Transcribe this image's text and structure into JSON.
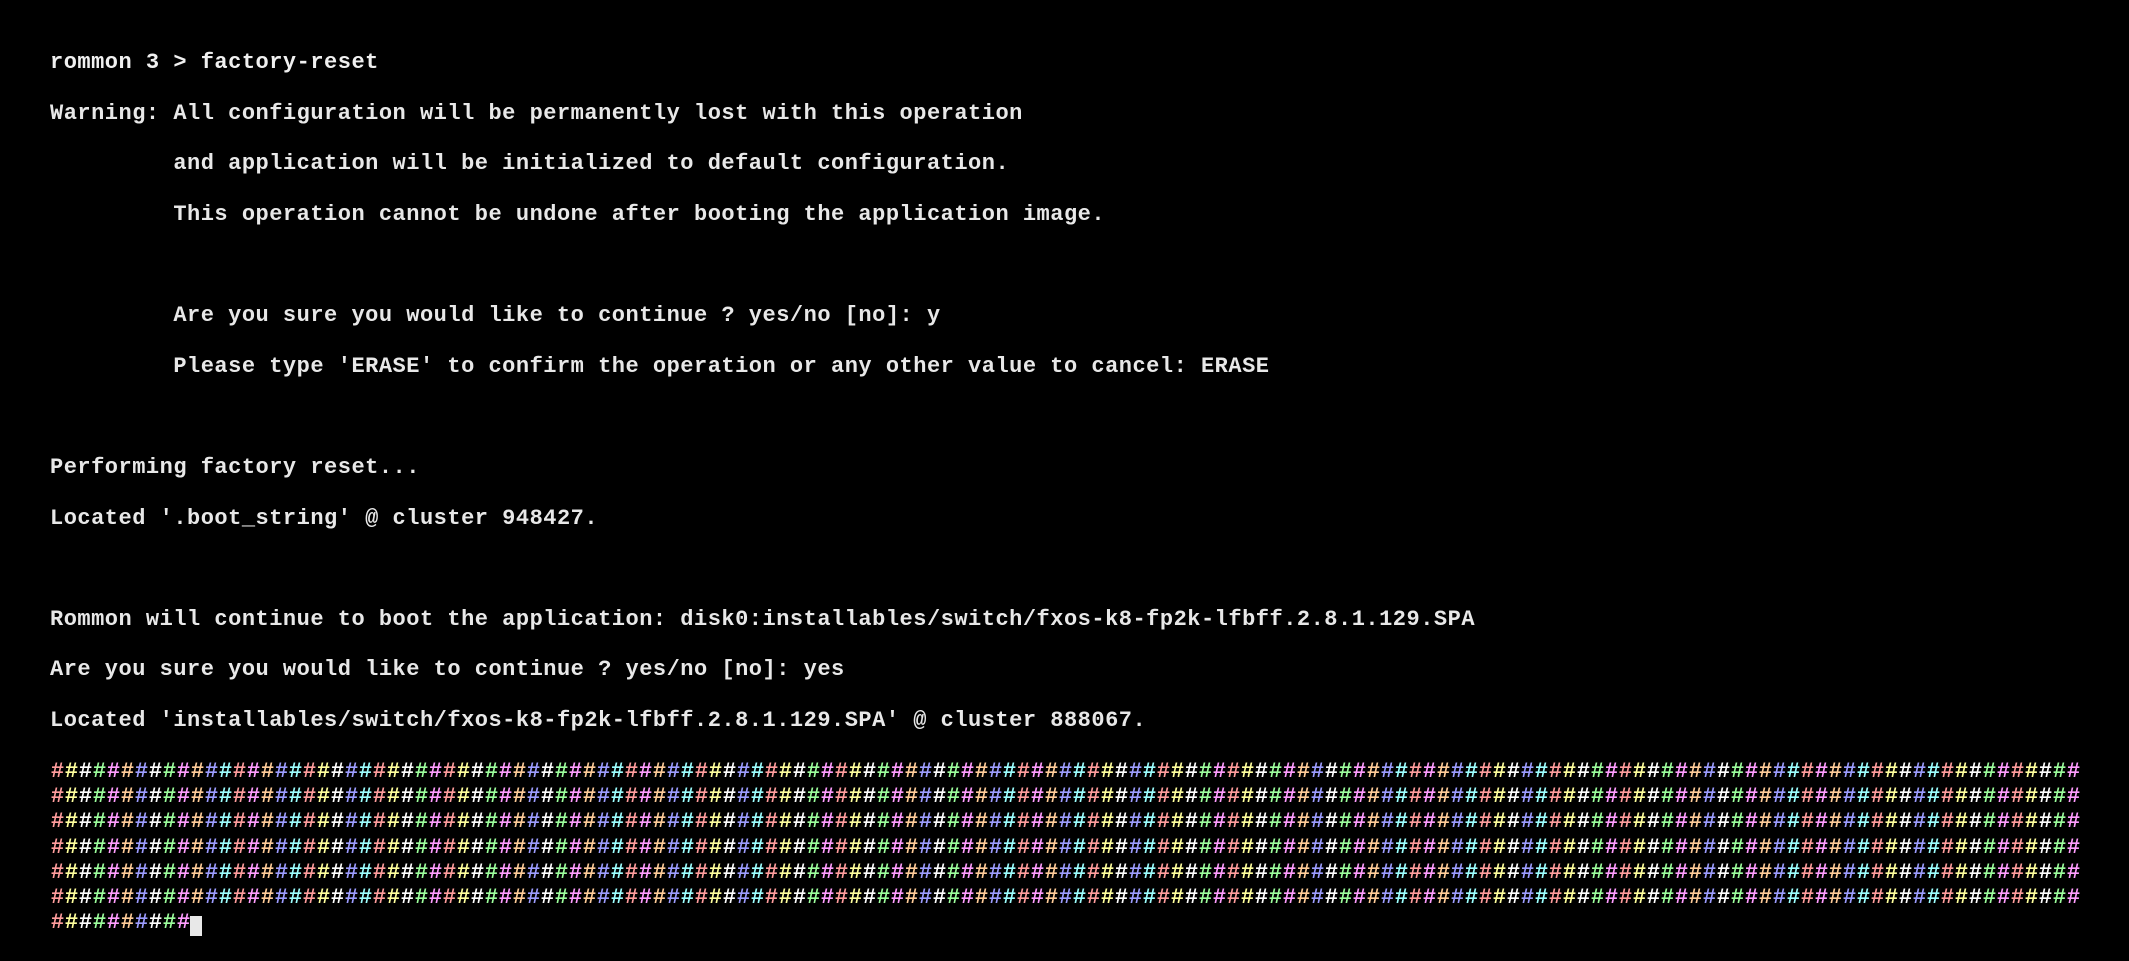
{
  "terminal": {
    "prompt_line": "rommon 3 > factory-reset",
    "warning_l1": "Warning: All configuration will be permanently lost with this operation",
    "warning_l2": "         and application will be initialized to default configuration.",
    "warning_l3": "         This operation cannot be undone after booting the application image.",
    "confirm_l1": "         Are you sure you would like to continue ? yes/no [no]: y",
    "confirm_l2": "         Please type 'ERASE' to confirm the operation or any other value to cancel: ERASE",
    "performing": "Performing factory reset...",
    "located1": "Located '.boot_string' @ cluster 948427.",
    "rommon_boot": "Rommon will continue to boot the application: disk0:installables/switch/fxos-k8-fp2k-lfbff.2.8.1.129.SPA",
    "confirm2": "Are you sure you would like to continue ? yes/no [no]: yes",
    "located2": "Located 'installables/switch/fxos-k8-fp2k-lfbff.2.8.1.129.SPA' @ cluster 888067.",
    "progress_full_rows": 6,
    "progress_full_row_length": 145,
    "progress_partial_length": 10
  }
}
